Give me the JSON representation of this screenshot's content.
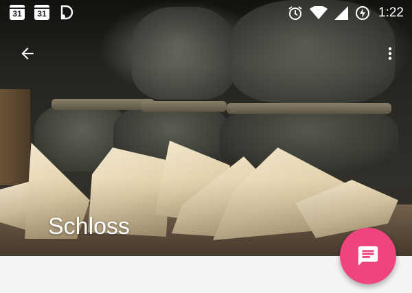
{
  "status_bar": {
    "calendar_icons": [
      "31",
      "31"
    ],
    "time": "1:22",
    "icons": [
      "calendar-icon",
      "calendar-icon",
      "d-app-icon",
      "alarm-icon",
      "wifi-icon",
      "signal-icon",
      "data-saver-icon"
    ]
  },
  "toolbar": {
    "back_icon": "arrow-back-icon",
    "menu_icon": "more-vert-icon"
  },
  "header": {
    "title": "Schloss"
  },
  "fab": {
    "icon": "message-icon",
    "color": "#f0447e"
  },
  "colors": {
    "content_background": "#f4f4f4"
  }
}
